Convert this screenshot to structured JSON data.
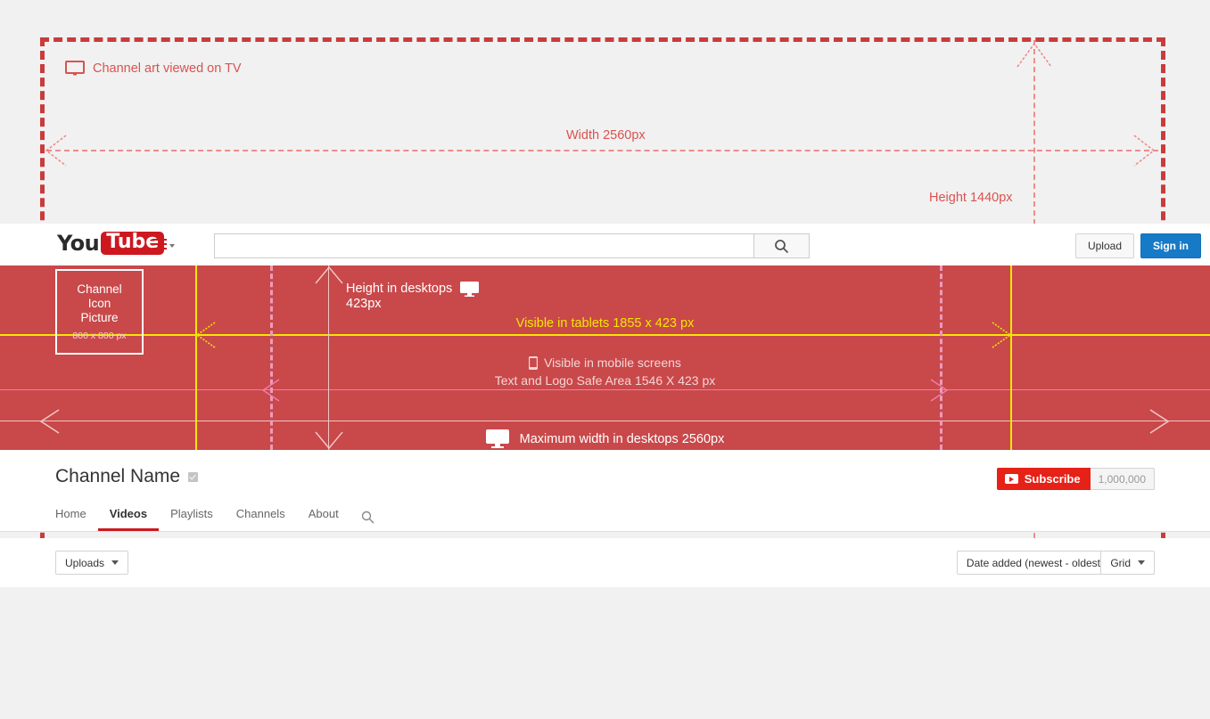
{
  "annotations": {
    "tv_label": "Channel art viewed on TV",
    "width_label": "Width  2560px",
    "height_label": "Height   1440px",
    "desktop_height_line1": "Height in desktops",
    "desktop_height_line2": "423px",
    "tablet_label": "Visible in tablets  1855 x 423 px",
    "mobile_label_line1": "Visible in mobile screens",
    "mobile_label_line2": "Text and Logo Safe Area   1546 X 423 px",
    "max_width_label": "Maximum width in desktops  2560px"
  },
  "channel_icon": {
    "line1": "Channel",
    "line2": "Icon",
    "line3": "Picture",
    "size": "800 x 800 px"
  },
  "masthead": {
    "logo_you": "You",
    "logo_tube": "Tube",
    "search_value": "",
    "search_placeholder": "",
    "upload_label": "Upload",
    "signin_label": "Sign in"
  },
  "channel": {
    "name": "Channel Name",
    "subscribe_label": "Subscribe",
    "subscriber_count": "1,000,000",
    "tabs": [
      {
        "label": "Home",
        "active": false
      },
      {
        "label": "Videos",
        "active": true
      },
      {
        "label": "Playlists",
        "active": false
      },
      {
        "label": "Channels",
        "active": false
      },
      {
        "label": "About",
        "active": false
      }
    ]
  },
  "toolbar": {
    "uploads_label": "Uploads",
    "sort_label": "Date added (newest - oldest)",
    "view_label": "Grid"
  },
  "colors": {
    "banner_red": "#c9484a",
    "guide_red": "#c83c3c",
    "guide_red_light": "#ef8c8c",
    "yellow": "#f2e600",
    "pink": "#f07eab",
    "youtube_red": "#cc181e",
    "subscribe_red": "#e62117",
    "signin_blue": "#167ac6",
    "page_bg": "#f1f1f1"
  },
  "icons": {
    "tv": "tv-icon",
    "desktop": "desktop-monitor-icon",
    "mobile": "mobile-phone-icon",
    "search": "search-icon",
    "hamburger": "hamburger-menu-icon",
    "verified": "verified-badge-icon",
    "play": "play-icon"
  }
}
